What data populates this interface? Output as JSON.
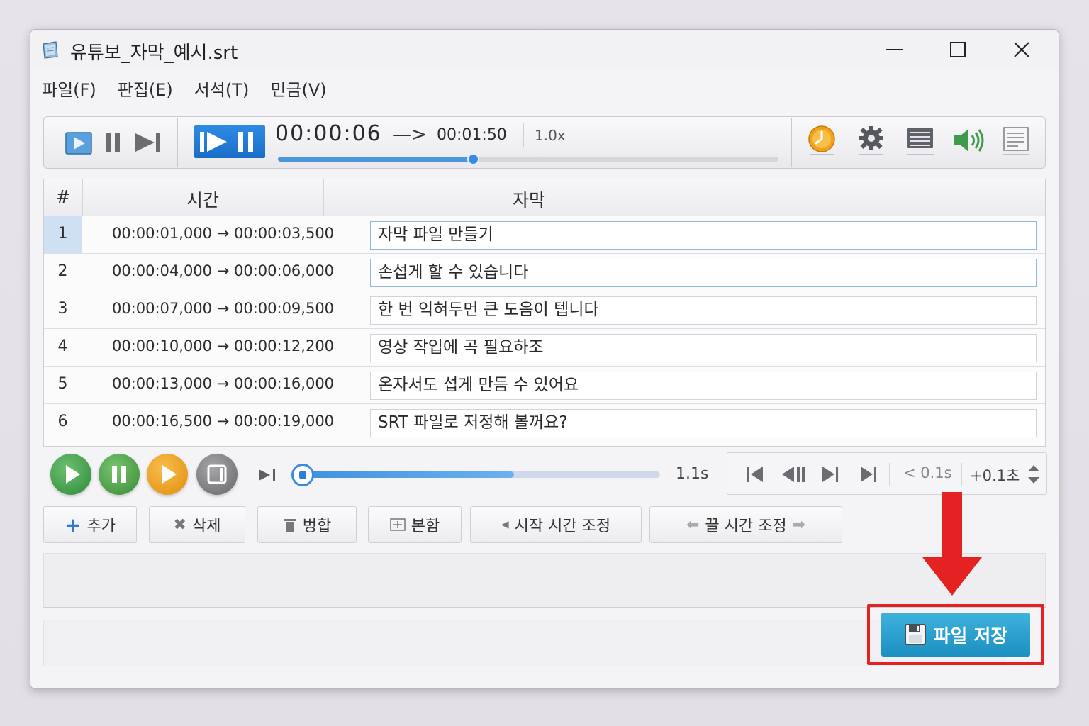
{
  "window": {
    "title": "유튜보_자막_예시.srt"
  },
  "menu": [
    {
      "label": "파일(F)"
    },
    {
      "label": "판집(E)"
    },
    {
      "label": "서석(T)"
    },
    {
      "label": "민금(V)"
    }
  ],
  "toolbar": {
    "current_time": "00:00:06",
    "arrow": "—>",
    "total_time": "00:01:50",
    "rate": "1.0x",
    "progress_fraction": 0.39
  },
  "table": {
    "headers": {
      "num": "#",
      "time": "시간",
      "subtitle": "자막"
    },
    "rows": [
      {
        "num": "1",
        "time": "00:00:01,000 → 00:00:03,500",
        "text": "자막 파일 만들기"
      },
      {
        "num": "2",
        "time": "00:00:04,000 → 00:00:06,000",
        "text": "손섭게 할 수 있습니다"
      },
      {
        "num": "3",
        "time": "00:00:07,000 → 00:00:09,500",
        "text": "한 번 익혀두먼 큰 도음이 텝니다"
      },
      {
        "num": "4",
        "time": "00:00:10,000 → 00:00:12,200",
        "text": "영상 작입에 곡 필요하조"
      },
      {
        "num": "5",
        "time": "00:00:13,000 → 00:00:16,000",
        "text": "온자서도 섭게 만듬 수 있어요"
      },
      {
        "num": "6",
        "time": "00:00:16,500 → 00:00:19,000",
        "text": "SRT 파일로 저정해 볼꺼요?"
      }
    ]
  },
  "playback": {
    "seek_label": "1.1s",
    "seek_fraction": 0.6,
    "nav_minus": "< 0.1s",
    "nav_plus": "+0.1초"
  },
  "actions": {
    "add": "추가",
    "delete": "삭제",
    "merge": "벙합",
    "split": "본함",
    "start_adjust": "시작 시간 조정",
    "end_adjust": "끌 시간 조정"
  },
  "save_button": {
    "label": "파일 저장"
  },
  "colors": {
    "accent": "#1a6dc7",
    "save": "#1b8fc0",
    "highlight": "#e42222"
  }
}
